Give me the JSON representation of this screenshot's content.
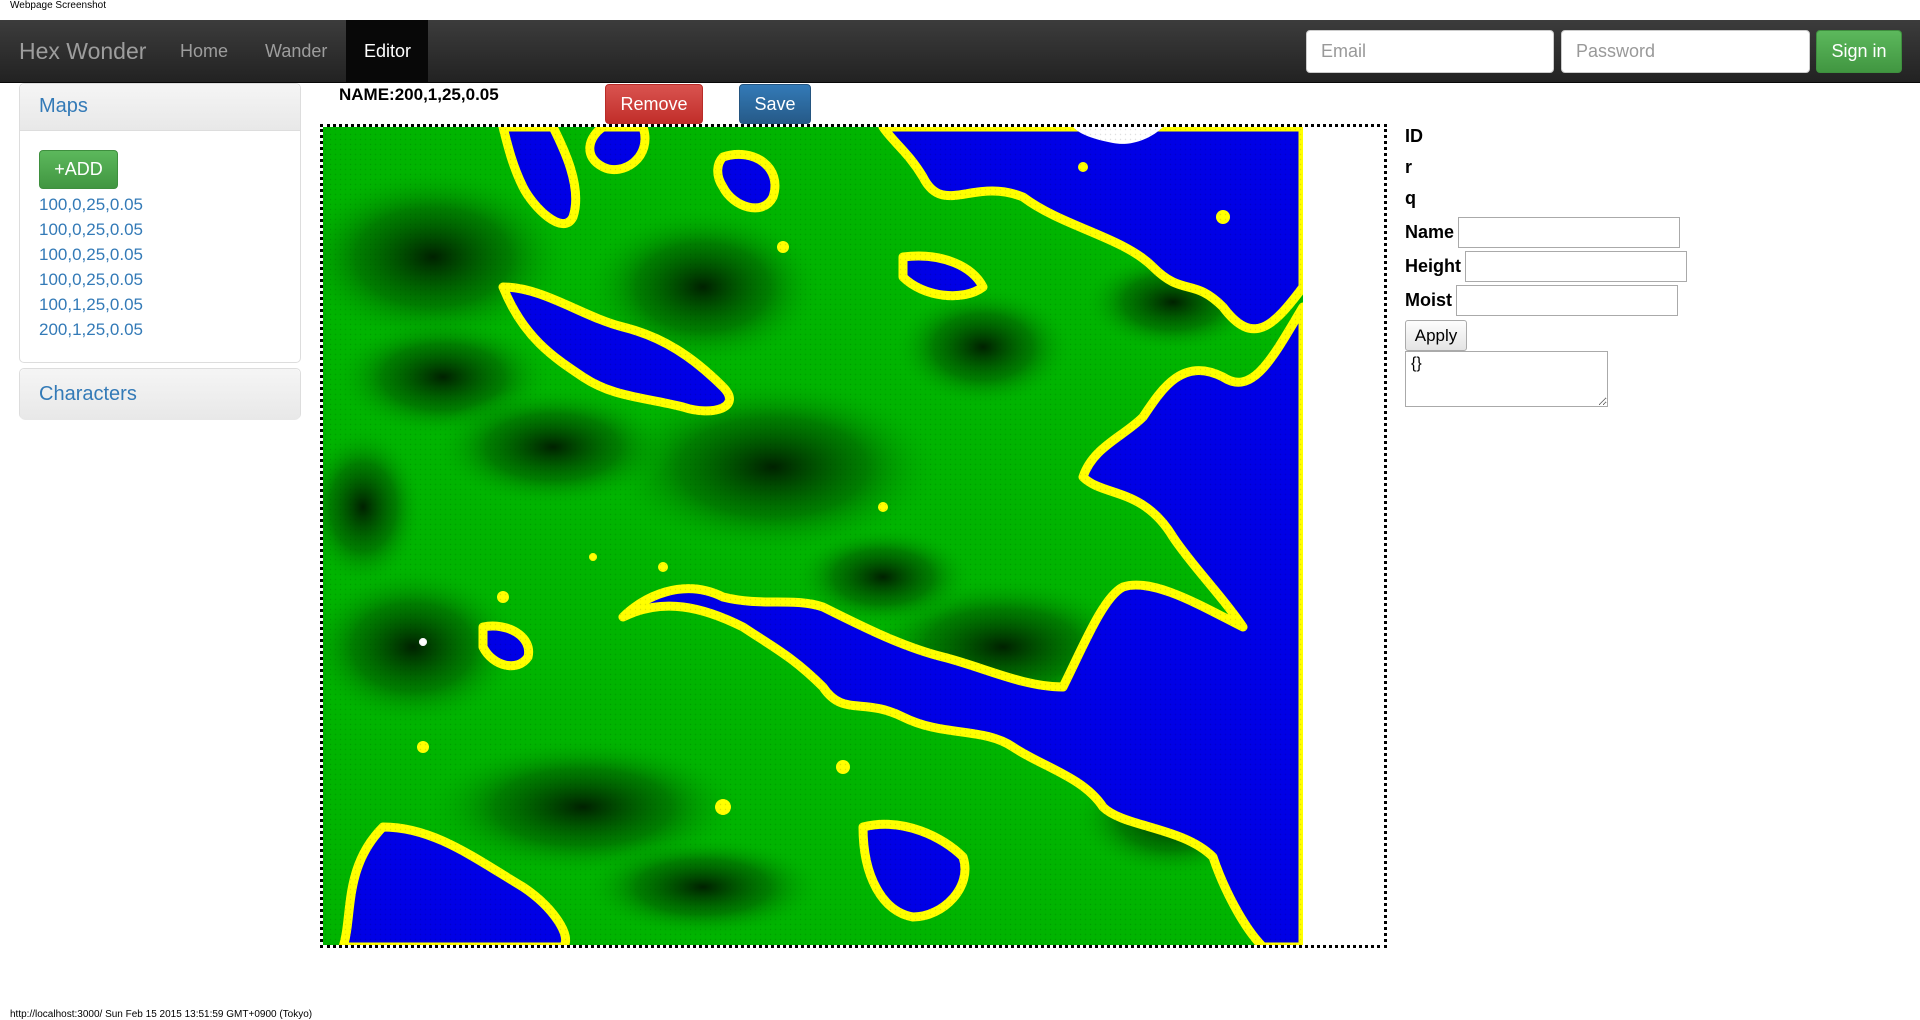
{
  "caption": "Webpage Screenshot",
  "footer_url": "http://localhost:3000/ Sun Feb 15 2015 13:51:59 GMT+0900 (Tokyo)",
  "navbar": {
    "brand": "Hex Wonder",
    "items": [
      {
        "label": "Home",
        "active": false
      },
      {
        "label": "Wander",
        "active": false
      },
      {
        "label": "Editor",
        "active": true
      }
    ],
    "email_placeholder": "Email",
    "password_placeholder": "Password",
    "signin_label": "Sign in"
  },
  "sidebar": {
    "maps": {
      "title": "Maps",
      "add_label": "+ADD",
      "items": [
        "100,0,25,0.05",
        "100,0,25,0.05",
        "100,0,25,0.05",
        "100,0,25,0.05",
        "100,1,25,0.05",
        "200,1,25,0.05"
      ]
    },
    "characters": {
      "title": "Characters"
    }
  },
  "editor": {
    "name_label": "NAME:200,1,25,0.05",
    "remove_label": "Remove",
    "save_label": "Save"
  },
  "map_colors": {
    "water": "#0000e6",
    "shore": "#ffff00",
    "land": "#00b400",
    "dark_land": "#003300",
    "snow": "#ffffff"
  },
  "inspector": {
    "id_label": "ID",
    "r_label": "r",
    "q_label": "q",
    "name_label": "Name",
    "height_label": "Height",
    "moist_label": "Moist",
    "apply_label": "Apply",
    "json_value": "{}"
  }
}
